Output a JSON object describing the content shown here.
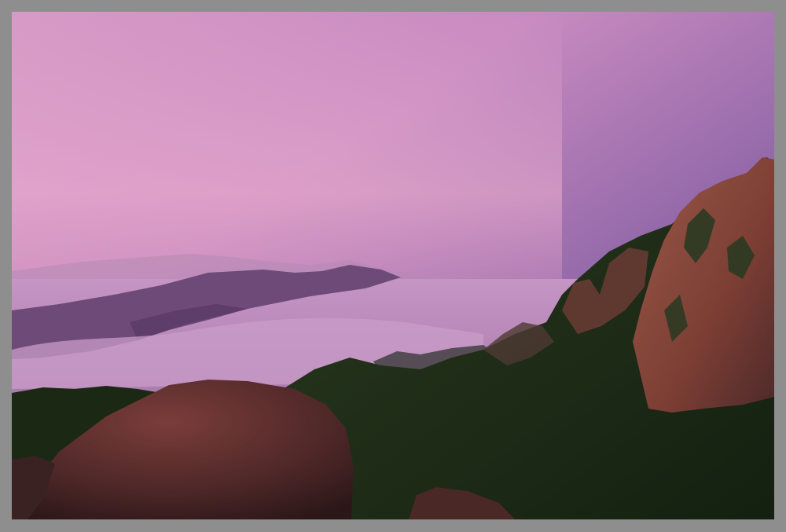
{
  "image": {
    "subject": "mountain-landscape-at-dusk",
    "colors": {
      "frame": "#8e8e8e",
      "sky_top": "#6d4a91",
      "sky_horizon": "#e9aac9",
      "fog": "#b889b4",
      "far_ridge": "#7d5a80",
      "forest": "#1d2b16",
      "cliff": "#8a4a3a",
      "boulder": "#5a2e2c"
    }
  }
}
